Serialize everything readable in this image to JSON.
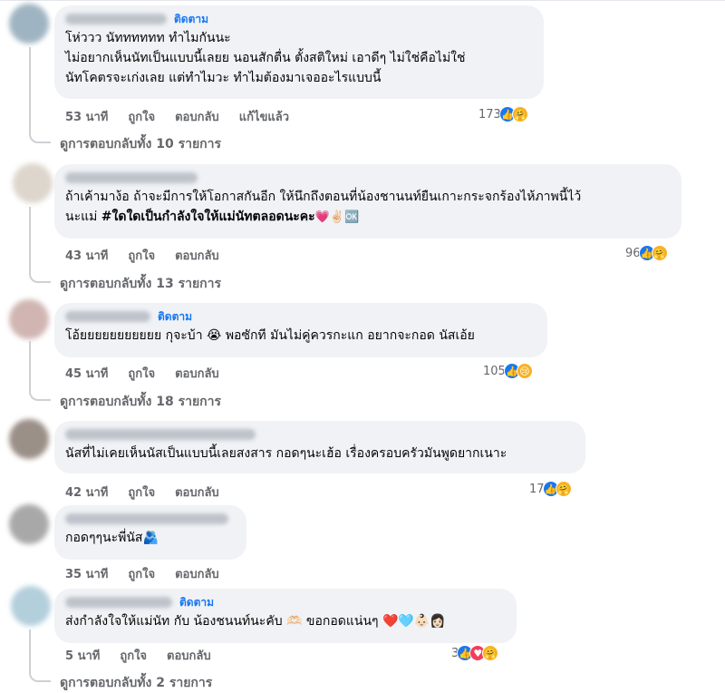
{
  "comments": [
    {
      "follow_label": "ติดตาม",
      "text_lines": [
        "โห่ววว นัทททททท ทำไมกันนะ",
        "ไม่อยากเห็นนัทเป็นแบบนี้เลยย นอนสักตื่น ตั้งสติใหม่ เอาดีๆ ไม่ใช่คือไม่ใช่",
        "นัทโคตรจะเก่งเลย แต่ทำไมวะ ทำไมต้องมาเจออะไรแบบนี้"
      ],
      "time": "53 นาที",
      "like_label": "ถูกใจ",
      "reply_label": "ตอบกลับ",
      "edited_label": "แก้ไขแล้ว",
      "reaction_count": "173",
      "reactions": [
        "like-icon",
        "care-icon"
      ],
      "replies_label": "ดูการตอบกลับทั้ง 10 รายการ",
      "avatar_color": "#8fa8b8"
    },
    {
      "follow_label": "",
      "text_lines": [
        "ถ้าเค้ามาง้อ ถ้าจะมีการให้โอกาสกันอีก ให้นึกถึงตอนที่น้องชานนท์ยืนเกาะกระจกร้องไห้ภาพนี้ไว้"
      ],
      "text_line2_plain": "นะแม่ ",
      "text_line2_bold": "#ใดใดเป็นกำลังใจให้แม่นัทตลอดนะคะ",
      "text_line2_emoji": "💗✌🏻🆗",
      "time": "43 นาที",
      "like_label": "ถูกใจ",
      "reply_label": "ตอบกลับ",
      "reaction_count": "96",
      "reactions": [
        "like-icon",
        "care-icon"
      ],
      "replies_label": "ดูการตอบกลับทั้ง 13 รายการ",
      "avatar_color": "#d8cfc4"
    },
    {
      "follow_label": "ติดตาม",
      "text_lines": [
        "โอ้ยยยยยยยยยยย กุจะบ้า 😭 พอซักที มันไม่คู่ควรกะแก อยากจะกอด นัสเอ้ย"
      ],
      "time": "45 นาที",
      "like_label": "ถูกใจ",
      "reply_label": "ตอบกลับ",
      "reaction_count": "105",
      "reactions": [
        "like-icon",
        "sad-icon"
      ],
      "replies_label": "ดูการตอบกลับทั้ง 18 รายการ",
      "avatar_color": "#c9a9a6"
    },
    {
      "follow_label": "",
      "text_lines": [
        "นัสที่ไม่เคยเห็นนัสเป็นแบบนี้เลยสงสาร กอดๆนะเฮ้อ เรื่องครอบครัวมันพูดยากเนาะ"
      ],
      "time": "42 นาที",
      "like_label": "ถูกใจ",
      "reply_label": "ตอบกลับ",
      "reaction_count": "17",
      "reactions": [
        "like-icon",
        "care-icon"
      ],
      "replies_label": "",
      "avatar_color": "#8a7d74"
    },
    {
      "follow_label": "",
      "text_lines": [
        "กอดๆๆนะพี่นัส🫂"
      ],
      "time": "35 นาที",
      "like_label": "ถูกใจ",
      "reply_label": "ตอบกลับ",
      "reaction_count": "",
      "reactions": [],
      "replies_label": "",
      "avatar_color": "#9a9a9a"
    },
    {
      "follow_label": "ติดตาม",
      "text_lines": [
        "ส่งกำลังใจให้แม่นัท กับ น้องชนนท์นะคับ 🫶🏻 ขอกอดแน่นๆ ❤️🩵👶🏻👩🏻"
      ],
      "time": "5 นาที",
      "like_label": "ถูกใจ",
      "reply_label": "ตอบกลับ",
      "reaction_count": "3",
      "reactions": [
        "like-icon",
        "heart-icon",
        "care-icon"
      ],
      "replies_label": "ดูการตอบกลับทั้ง 2 รายการ",
      "avatar_color": "#a6c7d6"
    }
  ],
  "colors": {
    "bubble": "#f0f2f5",
    "link_blue": "#1877f2",
    "muted": "#65676b"
  }
}
